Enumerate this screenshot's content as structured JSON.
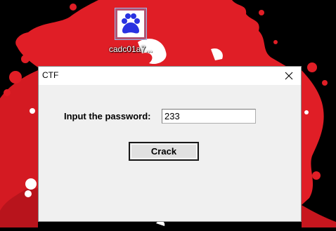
{
  "desktop": {
    "background_color": "#000000",
    "accent_color": "#e01e26",
    "icon": {
      "name": "baidu-paw-icon",
      "label": "cadc01a7..."
    }
  },
  "window": {
    "title": "CTF",
    "close_glyph": "✕",
    "password_label": "Input the password:",
    "password_value": "233",
    "crack_button_label": "Crack"
  }
}
